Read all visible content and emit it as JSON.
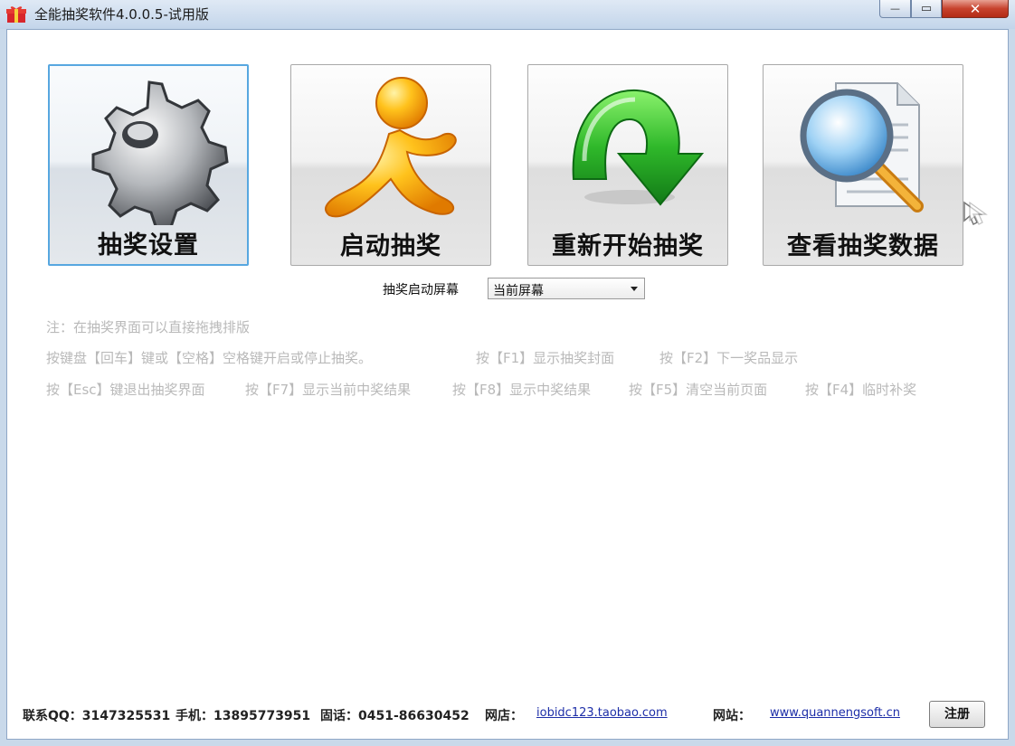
{
  "window": {
    "title": "全能抽奖软件4.0.0.5-试用版",
    "min_glyph": "—",
    "max_glyph": "▭",
    "close_glyph": "✕"
  },
  "tiles": [
    {
      "label": "抽奖设置",
      "icon": "gear-icon"
    },
    {
      "label": "启动抽奖",
      "icon": "runner-icon"
    },
    {
      "label": "重新开始抽奖",
      "icon": "restart-arrow-icon"
    },
    {
      "label": "查看抽奖数据",
      "icon": "magnifier-document-icon"
    }
  ],
  "screen": {
    "label": "抽奖启动屏幕",
    "selected": "当前屏幕"
  },
  "hints": {
    "note": "注：在抽奖界面可以直接拖拽排版",
    "line1": [
      "按键盘【回车】键或【空格】空格键开启或停止抽奖。",
      "按【F1】显示抽奖封面",
      "按【F2】下一奖品显示"
    ],
    "line2": [
      "按【Esc】键退出抽奖界面",
      "按【F7】显示当前中奖结果",
      "按【F8】显示中奖结果",
      "按【F5】清空当前页面",
      "按【F4】临时补奖"
    ]
  },
  "footer": {
    "qq": "联系QQ：3147325531",
    "phone": "手机：13895773951",
    "tel": "固话：0451-86630452",
    "shop_label": "网店：",
    "shop_link": "iobidc123.taobao.com",
    "site_label": "网站：",
    "site_link": "www.quannengsoft.cn",
    "register": "注册"
  },
  "colors": {
    "accent": "#57a7e0",
    "hint_text": "#b9b9b9",
    "link": "#1d2ea8",
    "close_button": "#c7422d"
  }
}
